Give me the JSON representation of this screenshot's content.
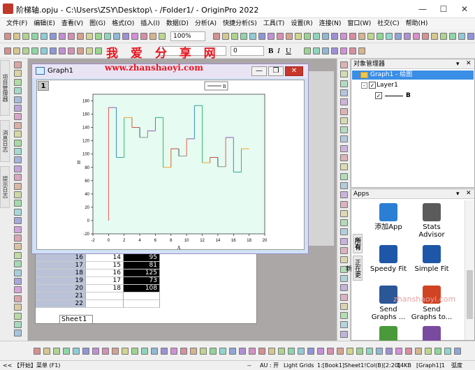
{
  "window": {
    "title": "阶梯轴.opju - C:\\Users\\ZSY\\Desktop\\ - /Folder1/ - OriginPro 2022"
  },
  "menu": [
    "文件(F)",
    "编辑(E)",
    "查看(V)",
    "图(G)",
    "格式(O)",
    "插入(I)",
    "数据(D)",
    "分析(A)",
    "快捷分析(S)",
    "工具(T)",
    "设置(R)",
    "连接(N)",
    "窗口(W)",
    "社交(C)",
    "帮助(H)"
  ],
  "toolbar": {
    "zoom": "100%",
    "font_size": "0",
    "style_zero": "0"
  },
  "watermark": {
    "cn": "我 爱 分 享 网",
    "url": "www.zhanshaoyi.com",
    "url2": "zhanshaoyi.com"
  },
  "left_tabs": [
    "项目管理器",
    "消息日志",
    "提示日志"
  ],
  "graph_window": {
    "title": "Graph1",
    "layer": "1"
  },
  "chart_data": {
    "type": "line",
    "title": "",
    "xlabel": "A",
    "ylabel": "B",
    "xlim": [
      -2,
      20
    ],
    "ylim": [
      -20,
      190
    ],
    "xticks": [
      "-2",
      "0",
      "2",
      "4",
      "6",
      "8",
      "10",
      "12",
      "14",
      "16",
      "18",
      "20"
    ],
    "yticks": [
      "-20",
      "0",
      "20",
      "40",
      "60",
      "80",
      "100",
      "120",
      "140",
      "160",
      "180"
    ],
    "legend": "B",
    "grid": false,
    "step_points": [
      [
        0,
        0
      ],
      [
        0,
        170
      ],
      [
        1,
        170
      ],
      [
        1,
        95
      ],
      [
        2,
        95
      ],
      [
        2,
        155
      ],
      [
        3,
        155
      ],
      [
        3,
        140
      ],
      [
        4,
        140
      ],
      [
        4,
        125
      ],
      [
        5,
        125
      ],
      [
        5,
        135
      ],
      [
        6,
        135
      ],
      [
        6,
        155
      ],
      [
        7,
        155
      ],
      [
        7,
        80
      ],
      [
        8,
        80
      ],
      [
        8,
        108
      ],
      [
        9,
        108
      ],
      [
        9,
        97
      ],
      [
        10,
        97
      ],
      [
        10,
        123
      ],
      [
        11,
        123
      ],
      [
        11,
        173
      ],
      [
        12,
        173
      ],
      [
        12,
        87
      ],
      [
        13,
        87
      ],
      [
        13,
        95
      ],
      [
        14,
        95
      ],
      [
        14,
        81
      ],
      [
        15,
        81
      ],
      [
        15,
        125
      ],
      [
        16,
        125
      ],
      [
        16,
        73
      ],
      [
        17,
        73
      ],
      [
        17,
        108
      ],
      [
        18,
        108
      ]
    ],
    "series_colors": [
      "#e74c3c",
      "#8e44ad",
      "#2980b9",
      "#16a085",
      "#27ae60",
      "#f39c12",
      "#d35400",
      "#c0392b",
      "#2c3e50",
      "#7f8c8d"
    ]
  },
  "worksheet": {
    "rows": [
      {
        "idx": "16",
        "a": "14",
        "b": "95"
      },
      {
        "idx": "17",
        "a": "15",
        "b": "81"
      },
      {
        "idx": "18",
        "a": "16",
        "b": "125"
      },
      {
        "idx": "19",
        "a": "17",
        "b": "73"
      },
      {
        "idx": "20",
        "a": "18",
        "b": "108"
      },
      {
        "idx": "21",
        "a": "",
        "b": ""
      },
      {
        "idx": "22",
        "a": "",
        "b": ""
      }
    ],
    "tab": "Sheet1"
  },
  "object_manager": {
    "title": "对象管理器",
    "graph": "Graph1 - 绘图",
    "layer": "Layer1",
    "plot": "B"
  },
  "apps": {
    "title": "Apps",
    "items": [
      {
        "label": "添加App",
        "icon": "add-app-icon",
        "color": "#2a7fd4"
      },
      {
        "label": "Stats Advisor",
        "icon": "wand-icon",
        "color": "#5b5b5b"
      },
      {
        "label": "Speedy Fit",
        "icon": "speedy-fit-icon",
        "color": "#1f57a8"
      },
      {
        "label": "Simple Fit",
        "icon": "simple-fit-icon",
        "color": "#1f57a8"
      },
      {
        "label": "Send Graphs ...",
        "icon": "send-word-icon",
        "color": "#2b5797"
      },
      {
        "label": "Send Graphs to...",
        "icon": "send-ppt-icon",
        "color": "#d04423"
      },
      {
        "label": "Graph",
        "icon": "graph-pub-icon",
        "color": "#4a9a3b"
      },
      {
        "label": "Graph",
        "icon": "graph-anim-icon",
        "color": "#7a4aa1"
      }
    ]
  },
  "side_tabs": {
    "all": "所有",
    "installed": "正在更新"
  },
  "status": {
    "start": "<< 【开始】菜单 (F1)",
    "dashes": "--",
    "au": "AU : 开",
    "theme": "Light Grids",
    "cell": "1:[Book1]Sheet1!Col(B)[2:20]",
    "size": "14KB",
    "layer": "[Graph1]1",
    "unit": "弧度"
  }
}
